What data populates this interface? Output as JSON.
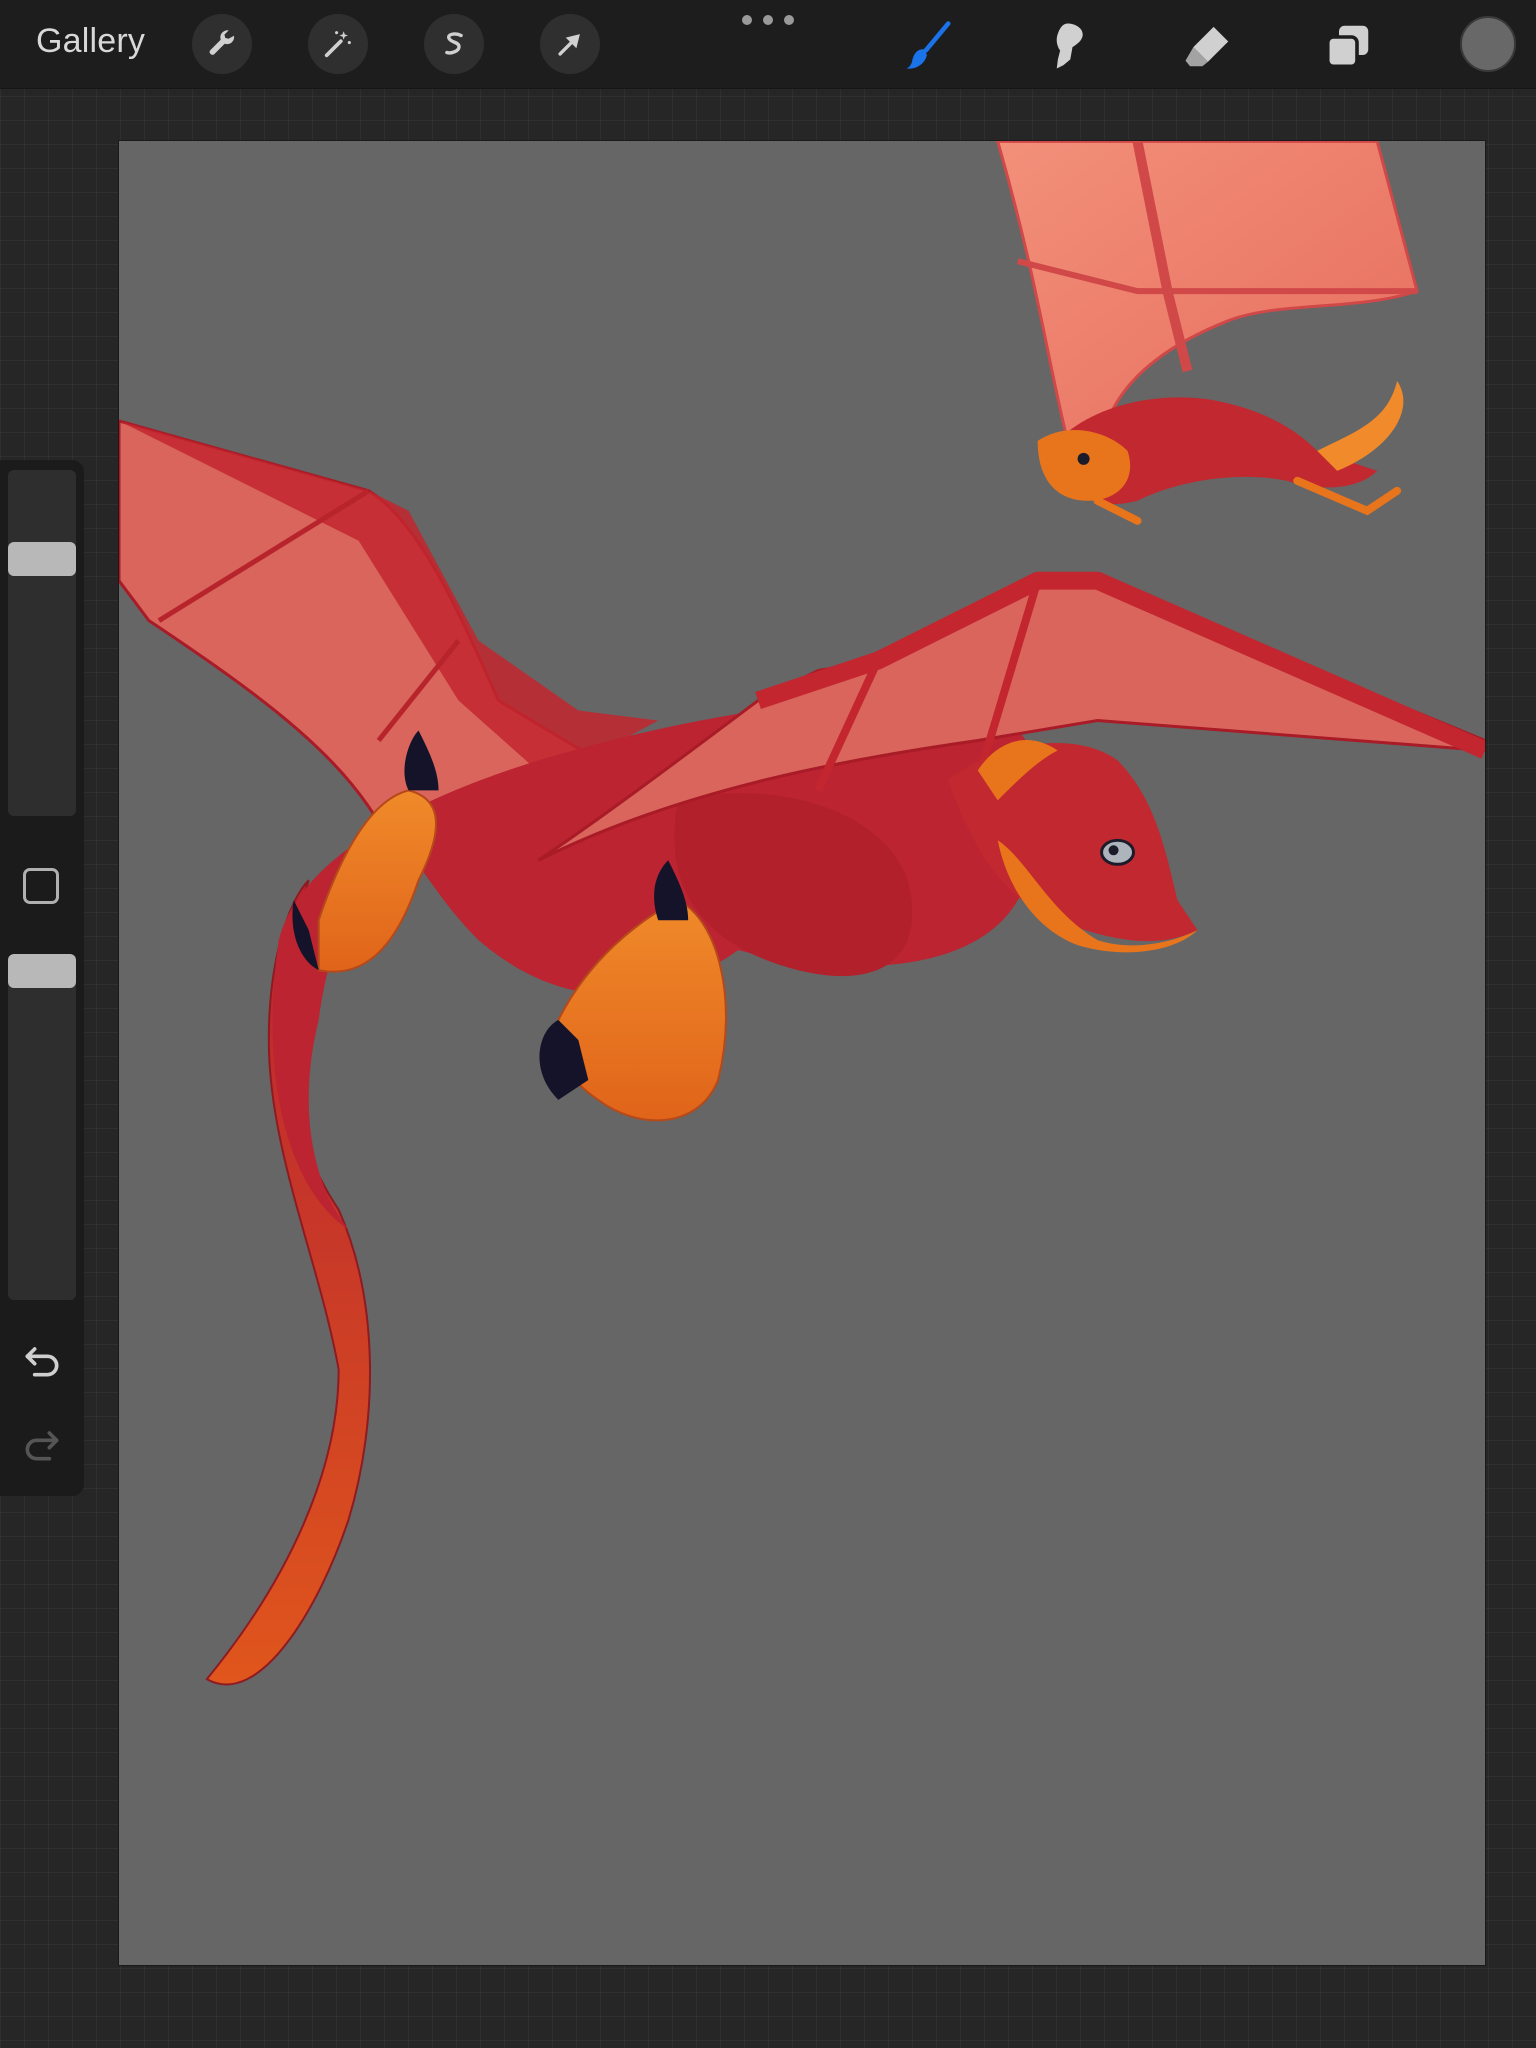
{
  "toolbar": {
    "gallery_label": "Gallery",
    "left_tools": [
      {
        "icon": "wrench-icon",
        "name": "actions"
      },
      {
        "icon": "magic-wand-icon",
        "name": "adjustments"
      },
      {
        "icon": "selection-s-icon",
        "name": "selection"
      },
      {
        "icon": "arrow-cursor-icon",
        "name": "transform"
      }
    ],
    "right_tools": [
      {
        "icon": "brush-icon",
        "name": "paint",
        "active": true
      },
      {
        "icon": "smudge-icon",
        "name": "smudge",
        "active": false
      },
      {
        "icon": "eraser-icon",
        "name": "eraser",
        "active": false
      },
      {
        "icon": "layers-icon",
        "name": "layers",
        "active": false
      }
    ],
    "more_icon": "ellipsis-icon"
  },
  "colors": {
    "active_tool": "#1a73e8",
    "inactive_tool": "#d0d0d0",
    "current_color": "#686868",
    "canvas_background": "#666666",
    "dragon_body": "#bb2430",
    "dragon_wing": "#d9655c",
    "dragon_claw": "#e8741c",
    "dragon_talon": "#14132a"
  },
  "sidebar": {
    "brush_size_level": 0.77,
    "opacity_level": 1.0,
    "modify_icon": "square-outline-icon",
    "undo_icon": "undo-icon",
    "redo_icon": "redo-icon",
    "redo_enabled": false
  }
}
